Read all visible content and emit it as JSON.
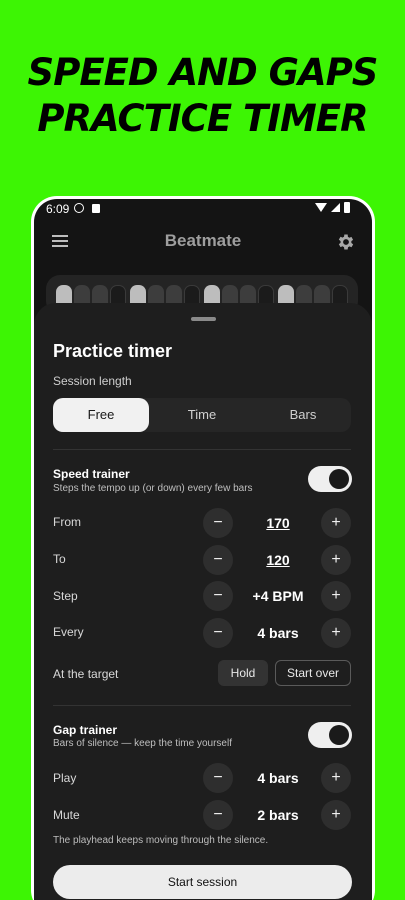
{
  "headline": {
    "line1": "SPEED AND GAPS",
    "line2": "PRACTICE TIMER"
  },
  "status_bar": {
    "time": "6:09"
  },
  "app_bar": {
    "title": "Beatmate",
    "menu_icon": "menu-icon",
    "settings_icon": "gear-icon"
  },
  "beat_strip": {
    "groups": [
      [
        "accent",
        "normal",
        "normal",
        "empty"
      ],
      [
        "accent",
        "normal",
        "normal",
        "empty"
      ],
      [
        "accent",
        "normal",
        "normal",
        "empty"
      ],
      [
        "accent",
        "normal",
        "normal",
        "empty"
      ]
    ]
  },
  "sheet": {
    "title": "Practice timer",
    "session_length_label": "Session length",
    "session_options": [
      "Free",
      "Time",
      "Bars"
    ],
    "selected_session": "Free",
    "speed_trainer": {
      "title": "Speed trainer",
      "subtitle": "Steps the tempo up (or down) every few bars",
      "enabled": true,
      "rows": [
        {
          "label": "From",
          "value": "170"
        },
        {
          "label": "To",
          "value": "120"
        },
        {
          "label": "Step",
          "value": "+4 BPM"
        },
        {
          "label": "Every",
          "value": "4 bars"
        }
      ],
      "at_target_label": "At the target",
      "at_target_options": [
        "Hold",
        "Start over"
      ],
      "at_target_selected": "Hold"
    },
    "gap_trainer": {
      "title": "Gap trainer",
      "subtitle": "Bars of silence — keep the time yourself",
      "enabled": true,
      "rows": [
        {
          "label": "Play",
          "value": "4 bars"
        },
        {
          "label": "Mute",
          "value": "2 bars"
        }
      ],
      "note": "The playhead keeps moving through the silence."
    },
    "minus_symbol": "−",
    "plus_symbol": "+",
    "start_button": "Start session"
  },
  "colors": {
    "background": "#3df504",
    "sheet": "#1e1e1e",
    "accent_light": "#f1f1f1"
  }
}
